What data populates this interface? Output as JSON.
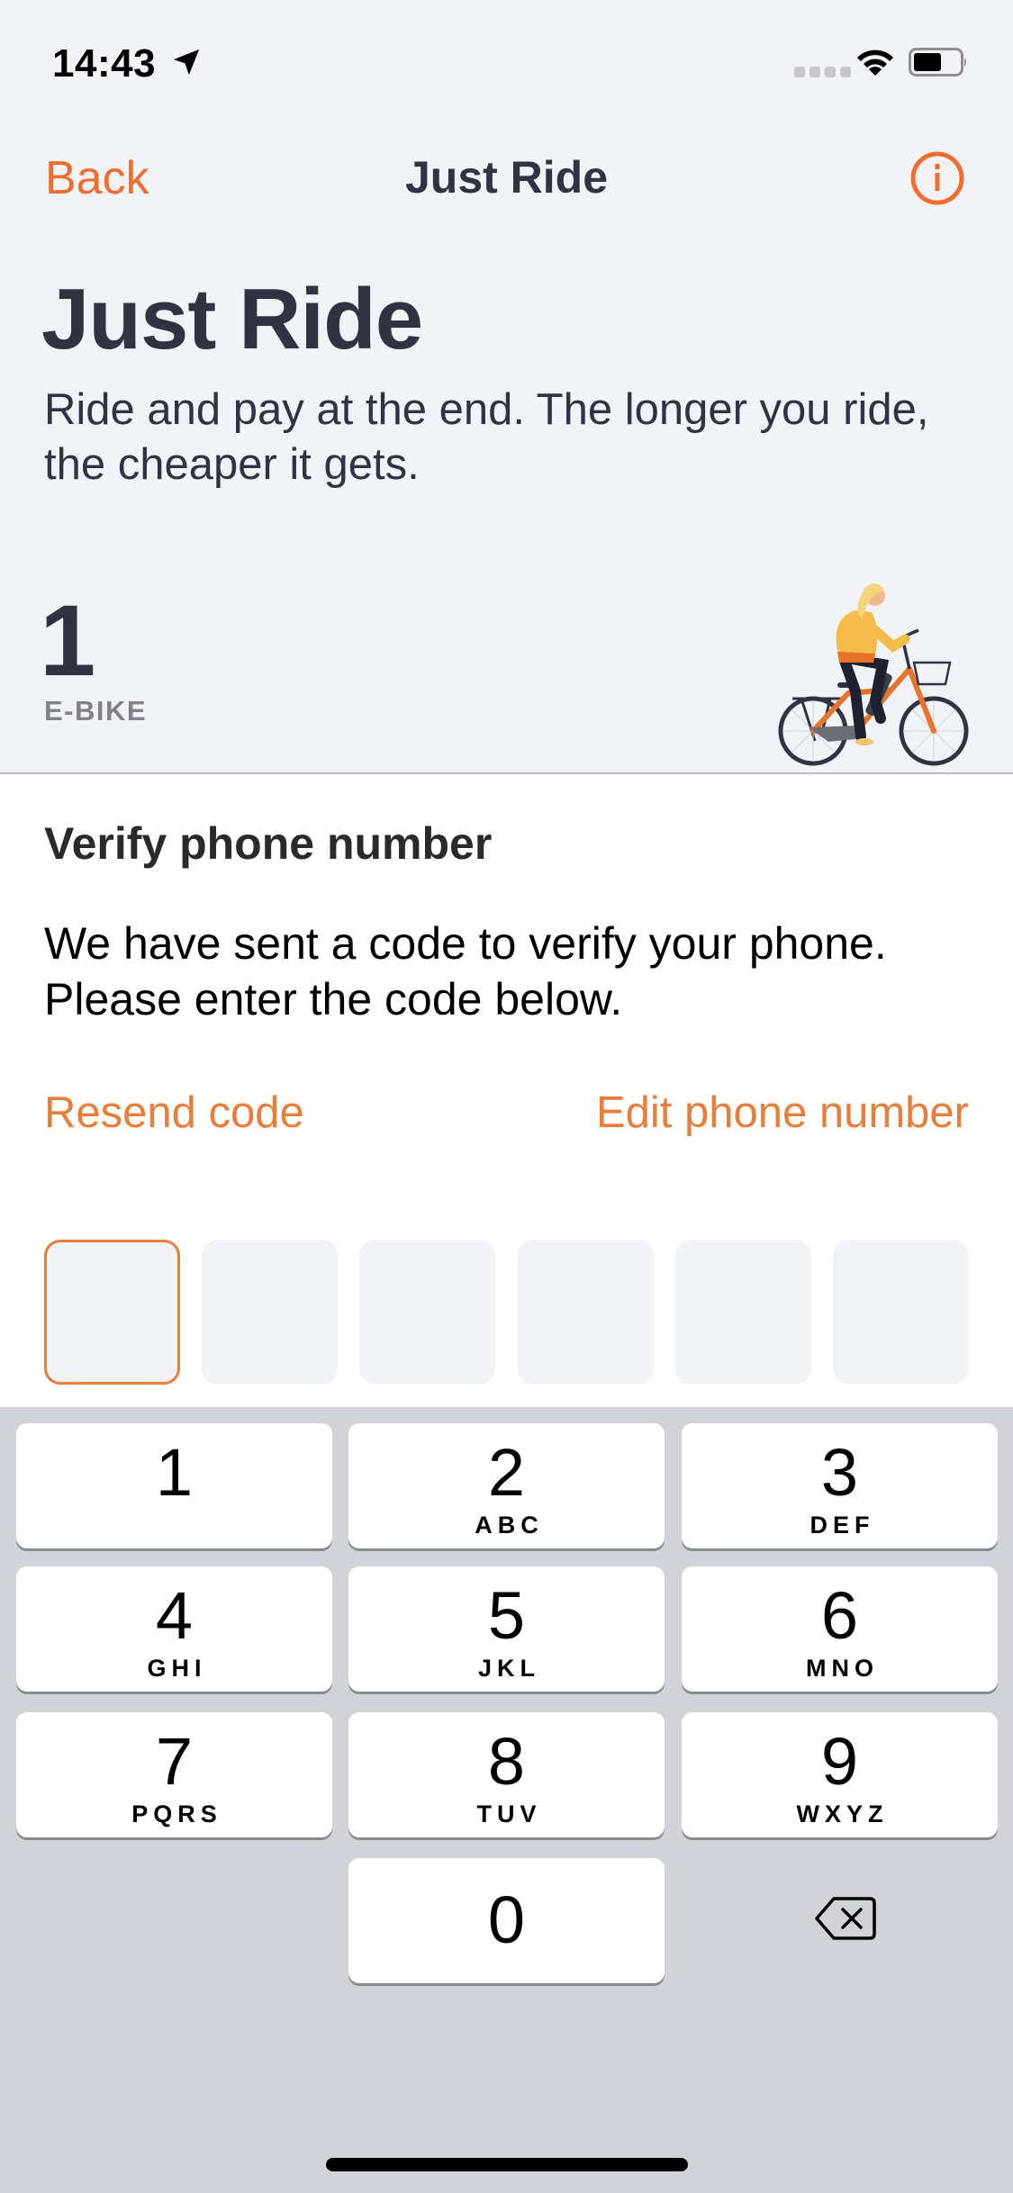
{
  "status_bar": {
    "time": "14:43",
    "location_icon": "location-arrow-icon",
    "signal_icon": "cellular-signal-icon",
    "wifi_icon": "wifi-icon",
    "battery_icon": "battery-icon"
  },
  "nav": {
    "back_label": "Back",
    "title": "Just Ride",
    "info_icon": "info-circle-icon"
  },
  "header": {
    "title": "Just Ride",
    "subtitle": "Ride and pay at the end. The longer you ride, the cheaper it gets.",
    "vehicle_count": "1",
    "vehicle_label": "E-BIKE",
    "illustration": "cyclist-on-ebike"
  },
  "verify": {
    "title": "Verify phone number",
    "body_line1": "We have sent a code to verify your phone.",
    "body_line2": "Please enter the code below.",
    "resend_label": "Resend code",
    "edit_label": "Edit phone number",
    "code_length": 6,
    "code_values": [
      "",
      "",
      "",
      "",
      "",
      ""
    ],
    "active_index": 0
  },
  "keyboard": {
    "keys": [
      {
        "digit": "1",
        "letters": ""
      },
      {
        "digit": "2",
        "letters": "ABC"
      },
      {
        "digit": "3",
        "letters": "DEF"
      },
      {
        "digit": "4",
        "letters": "GHI"
      },
      {
        "digit": "5",
        "letters": "JKL"
      },
      {
        "digit": "6",
        "letters": "MNO"
      },
      {
        "digit": "7",
        "letters": "PQRS"
      },
      {
        "digit": "8",
        "letters": "TUV"
      },
      {
        "digit": "9",
        "letters": "WXYZ"
      },
      {
        "digit": "0",
        "letters": ""
      }
    ],
    "delete_icon": "backspace-icon"
  },
  "colors": {
    "accent": "#ef6e2e",
    "link": "#e87e3a",
    "text_dark": "#2f3342",
    "background": "#f2f3f7",
    "keyboard_bg": "#d1d3d9"
  }
}
